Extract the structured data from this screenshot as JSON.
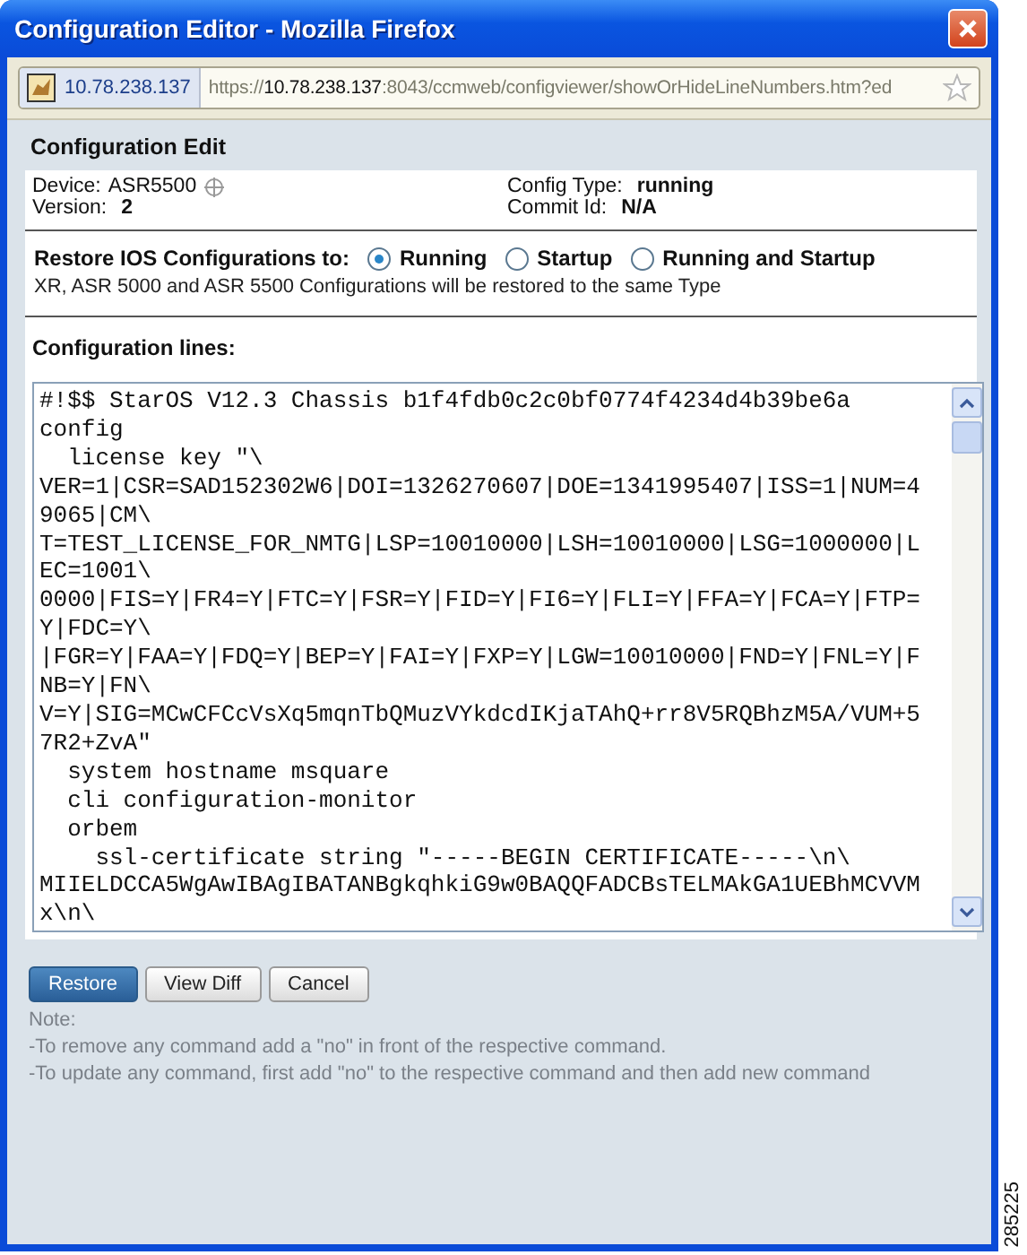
{
  "window": {
    "title": "Configuration Editor - Mozilla Firefox"
  },
  "address_bar": {
    "site": "10.78.238.137",
    "url_prefix": "https://",
    "url_host": "10.78.238.137",
    "url_rest": ":8043/ccmweb/configviewer/showOrHideLineNumbers.htm?ed"
  },
  "heading": "Configuration Edit",
  "info": [
    {
      "label": "Device:",
      "value": "ASR5500",
      "kind": "device"
    },
    {
      "label": "Config Type:",
      "value": "running",
      "kind": "plain"
    },
    {
      "label": "Version:",
      "value": "2",
      "kind": "plain"
    },
    {
      "label": "Commit Id:",
      "value": "N/A",
      "kind": "plain"
    }
  ],
  "restore": {
    "label": "Restore IOS Configurations to:",
    "options": [
      {
        "label": "Running",
        "selected": true
      },
      {
        "label": "Startup",
        "selected": false
      },
      {
        "label": "Running and Startup",
        "selected": false
      }
    ],
    "note": "XR, ASR 5000 and ASR 5500 Configurations will be restored to the same Type"
  },
  "config_lines": {
    "label": "Configuration lines:",
    "lines": [
      "#!$$ StarOS V12.3 Chassis b1f4fdb0c2c0bf0774f4234d4b39be6a",
      "config",
      "  license key \"\\",
      "VER=1|CSR=SAD152302W6|DOI=1326270607|DOE=1341995407|ISS=1|NUM=4",
      "9065|CM\\",
      "T=TEST_LICENSE_FOR_NMTG|LSP=10010000|LSH=10010000|LSG=1000000|L",
      "EC=1001\\",
      "0000|FIS=Y|FR4=Y|FTC=Y|FSR=Y|FID=Y|FI6=Y|FLI=Y|FFA=Y|FCA=Y|FTP=",
      "Y|FDC=Y\\",
      "|FGR=Y|FAA=Y|FDQ=Y|BEP=Y|FAI=Y|FXP=Y|LGW=10010000|FND=Y|FNL=Y|F",
      "NB=Y|FN\\",
      "V=Y|SIG=MCwCFCcVsXq5mqnTbQMuzVYkdcdIKjaTAhQ+rr8V5RQBhzM5A/VUM+5",
      "7R2+ZvA\"",
      "  system hostname msquare",
      "  cli configuration-monitor",
      "  orbem",
      "    ssl-certificate string \"-----BEGIN CERTIFICATE-----\\n\\",
      "MIIELDCCA5WgAwIBAgIBATANBgkqhkiG9w0BAQQFADCBsTELMAkGA1UEBhMCVVM",
      "x\\n\\"
    ]
  },
  "buttons": [
    {
      "label": "Restore",
      "kind": "primary"
    },
    {
      "label": "View Diff",
      "kind": "secondary"
    },
    {
      "label": "Cancel",
      "kind": "secondary"
    }
  ],
  "notes": [
    "Note:",
    "-To remove any command add a \"no\" in front of the respective command.",
    "-To update any command, first add \"no\" to the respective command and then add new command"
  ],
  "figure_id": "285225"
}
